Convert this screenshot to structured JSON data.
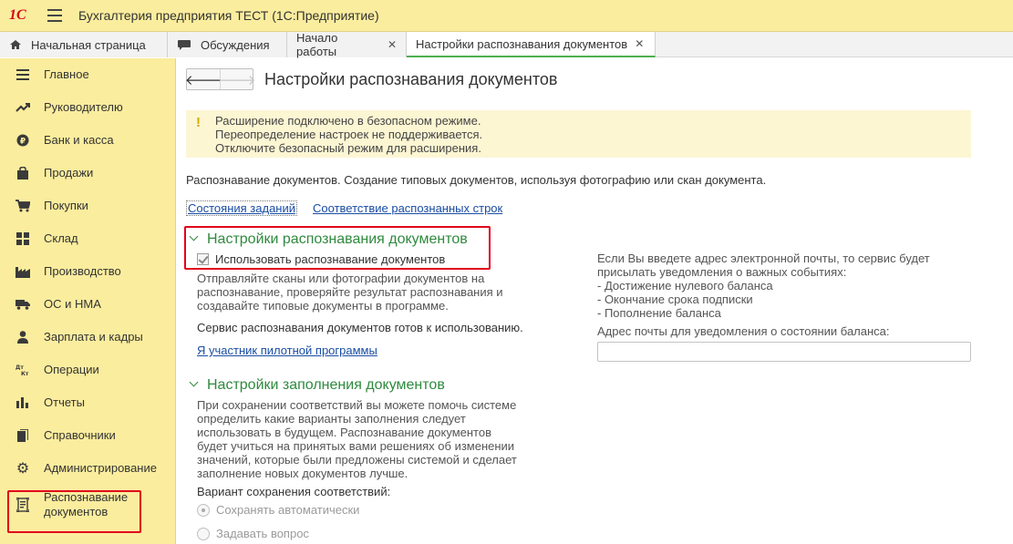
{
  "app": {
    "logo": "1С",
    "title": "Бухгалтерия предприятия ТЕСТ  (1С:Предприятие)"
  },
  "tabs": [
    {
      "label": "Начальная страница",
      "icon": "home-icon",
      "closable": false
    },
    {
      "label": "Обсуждения",
      "icon": "chat-icon",
      "closable": false
    },
    {
      "label": "Начало работы",
      "closable": true
    },
    {
      "label": "Настройки распознавания документов",
      "closable": true,
      "active": true
    }
  ],
  "sidebar": {
    "items": [
      {
        "label": "Главное",
        "icon": "menu-list-icon"
      },
      {
        "label": "Руководителю",
        "icon": "trend-icon"
      },
      {
        "label": "Банк и касса",
        "icon": "ruble-coin-icon"
      },
      {
        "label": "Продажи",
        "icon": "shopping-bag-icon"
      },
      {
        "label": "Покупки",
        "icon": "cart-icon"
      },
      {
        "label": "Склад",
        "icon": "warehouse-icon"
      },
      {
        "label": "Производство",
        "icon": "factory-icon"
      },
      {
        "label": "ОС и НМА",
        "icon": "truck-icon"
      },
      {
        "label": "Зарплата и кадры",
        "icon": "person-icon"
      },
      {
        "label": "Операции",
        "icon": "dt-kt-icon",
        "icon_text": "Дт\nКт"
      },
      {
        "label": "Отчеты",
        "icon": "bar-chart-icon"
      },
      {
        "label": "Справочники",
        "icon": "book-icon"
      },
      {
        "label": "Администрирование",
        "icon": "gear-icon"
      },
      {
        "label": "Распознавание\nдокументов",
        "icon": "scan-document-icon",
        "highlighted": true
      }
    ]
  },
  "page": {
    "title": "Настройки распознавания документов",
    "warning": [
      "Расширение подключено в безопасном режиме.",
      "Переопределение настроек не поддерживается.",
      "Отключите безопасный режим для расширения."
    ],
    "warning_icon": "!",
    "description": "Распознавание документов. Создание типовых документов, используя фотографию или скан документа.",
    "links": {
      "job_states": "Состояния заданий",
      "row_mapping": "Соответствие распознанных строк"
    },
    "recognition_group": {
      "title": "Настройки распознавания документов",
      "checkbox_label": "Использовать распознавание документов",
      "checkbox_checked": true,
      "hint": [
        "Отправляйте сканы или фотографии документов на",
        "распознавание, проверяйте результат распознавания и",
        "создавайте типовые документы в программе."
      ],
      "status": "Сервис распознавания документов готов к использованию.",
      "pilot_link": "Я участник пилотной программы"
    },
    "email_info": [
      "Если Вы введете адрес электронной почты, то сервис будет",
      "присылать уведомления о важных событиях:",
      "- Достижение нулевого баланса",
      "- Окончание срока подписки",
      "- Пополнение баланса"
    ],
    "email_label": "Адрес почты для уведомления о состоянии баланса:",
    "email_value": "",
    "filling_group": {
      "title": "Настройки заполнения документов",
      "hint": [
        "При сохранении соответствий вы можете помочь системе",
        "определить какие варианты заполнения следует",
        "использовать в будущем. Распознавание документов",
        "будет учиться на принятых вами решениях об изменении",
        "значений, которые были предложены системой и сделает",
        "заполнение новых документов лучше."
      ],
      "variant_label": "Вариант сохранения соответствий:",
      "options": [
        "Сохранять автоматически",
        "Задавать вопрос"
      ],
      "selected_option": 0
    }
  },
  "colors": {
    "accent_yellow": "#fbed9e",
    "group_green": "#2f8a3e",
    "link_blue": "#1a4da3",
    "highlight_red": "#e0001b"
  }
}
